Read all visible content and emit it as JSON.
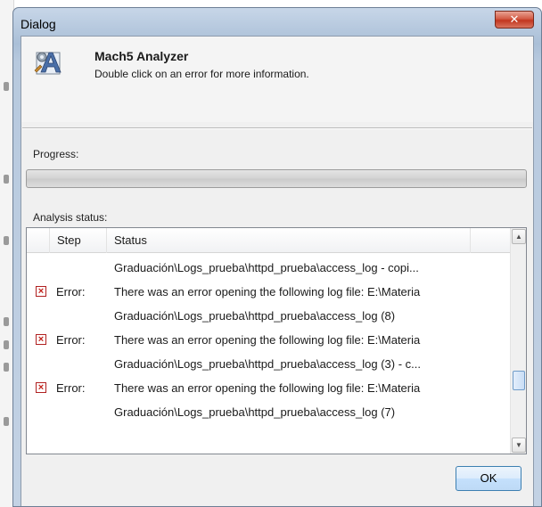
{
  "window": {
    "title": "Dialog",
    "close_glyph": "✕"
  },
  "header": {
    "app_name": "Mach5 Analyzer",
    "instruction": "Double click on an error for more information.",
    "icon": "mach5-analyzer-app-icon"
  },
  "progress": {
    "label": "Progress:",
    "value_fraction": 0,
    "fill_color": "#3fb437"
  },
  "analysis": {
    "label": "Analysis status:",
    "columns": [
      "Step",
      "Status"
    ],
    "rows": [
      {
        "icon": "",
        "step": "",
        "status": "Graduación\\Logs_prueba\\httpd_prueba\\access_log - copi..."
      },
      {
        "icon": "error-x-icon",
        "step": "Error:",
        "status": "There was an error opening the following log file: E:\\Materia"
      },
      {
        "icon": "",
        "step": "",
        "status": "Graduación\\Logs_prueba\\httpd_prueba\\access_log (8)"
      },
      {
        "icon": "error-x-icon",
        "step": "Error:",
        "status": "There was an error opening the following log file: E:\\Materia"
      },
      {
        "icon": "",
        "step": "",
        "status": "Graduación\\Logs_prueba\\httpd_prueba\\access_log (3) - c..."
      },
      {
        "icon": "error-x-icon",
        "step": "Error:",
        "status": "There was an error opening the following log file: E:\\Materia"
      },
      {
        "icon": "",
        "step": "",
        "status": "Graduación\\Logs_prueba\\httpd_prueba\\access_log (7)"
      }
    ]
  },
  "buttons": {
    "ok": "OK"
  },
  "colors": {
    "error_red": "#c1221a",
    "ok_border": "#3c7fb1",
    "close_red": "#c2361f"
  }
}
